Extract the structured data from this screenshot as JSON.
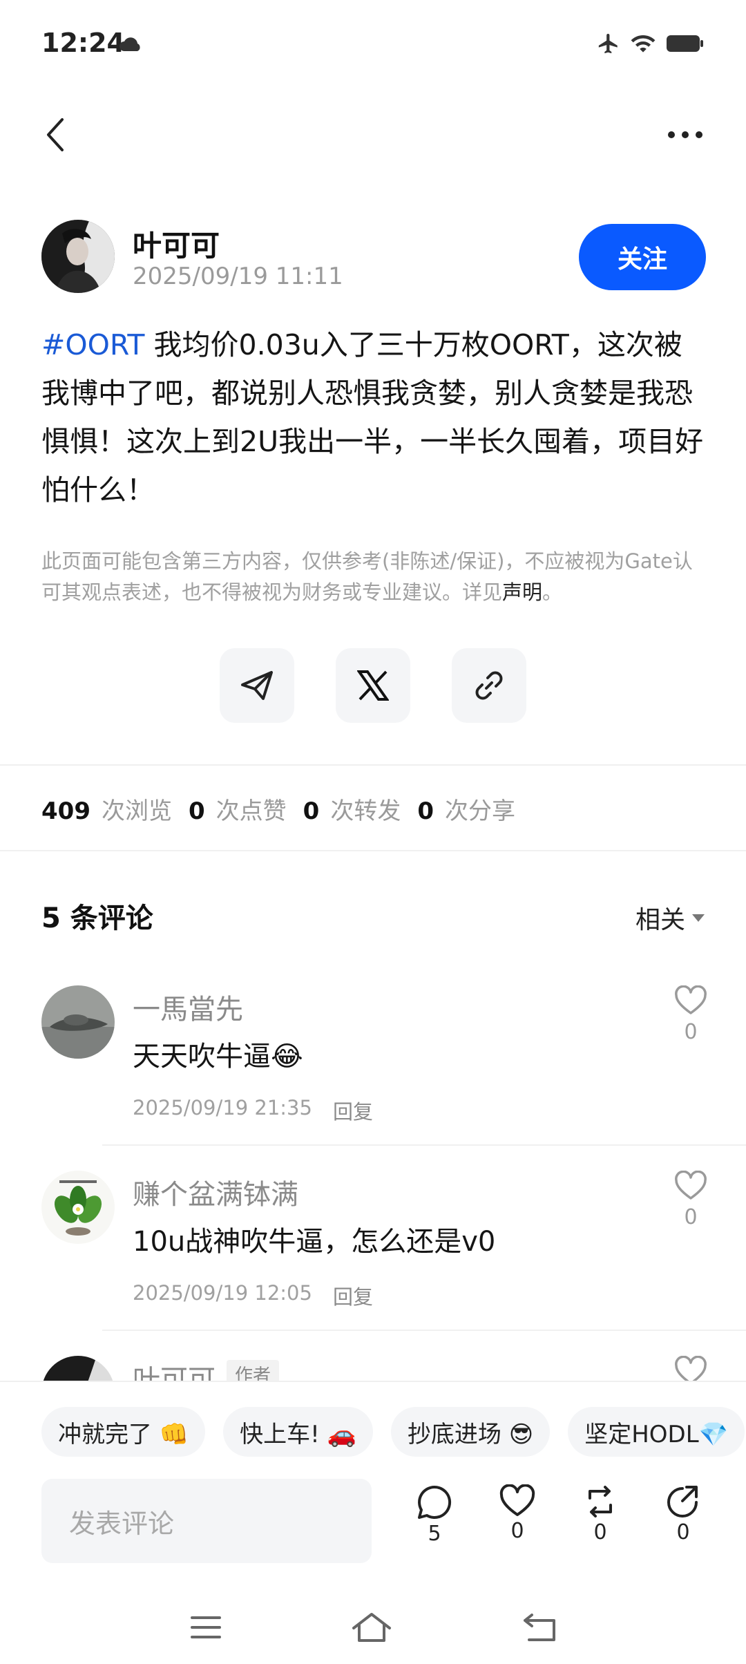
{
  "status_bar": {
    "time": "12:24"
  },
  "post": {
    "author_name": "叶可可",
    "author_time": "2025/09/19 11:11",
    "follow_label": "关注",
    "hashtag": "#OORT",
    "body": " 我均价0.03u入了三十万枚OORT，这次被我博中了吧，都说别人恐惧我贪婪，别人贪婪是我恐惧惧！这次上到2U我出一半，一半长久囤着，项目好怕什么！",
    "disclaimer": "此页面可能包含第三方内容，仅供参考(非陈述/保证)，不应被视为Gate认可其观点表述，也不得被视为财务或专业建议。详见",
    "disclaimer_link": "声明",
    "disclaimer_end": "。"
  },
  "stats": {
    "views": "409",
    "views_label": "次浏览",
    "likes": "0",
    "likes_label": "次点赞",
    "reposts": "0",
    "reposts_label": "次转发",
    "shares": "0",
    "shares_label": "次分享"
  },
  "comments_section": {
    "title": "5 条评论",
    "sort_label": "相关",
    "comments": [
      {
        "name": "一馬當先",
        "text": "天天吹牛逼😂",
        "time": "2025/09/19 21:35",
        "reply": "回复",
        "likes": "0"
      },
      {
        "name": "赚个盆满钵满",
        "text": "10u战神吹牛逼，怎么还是v0",
        "time": "2025/09/19 12:05",
        "reply": "回复",
        "likes": "0"
      },
      {
        "name": "叶可可",
        "tag": "作者"
      }
    ]
  },
  "quick_replies": [
    "冲就完了 👊",
    "快上车! 🚗",
    "抄底进场 😎",
    "坚定HODL💎"
  ],
  "bottom_bar": {
    "input_placeholder": "发表评论",
    "comment_count": "5",
    "like_count": "0",
    "repost_count": "0",
    "share_count": "0"
  }
}
